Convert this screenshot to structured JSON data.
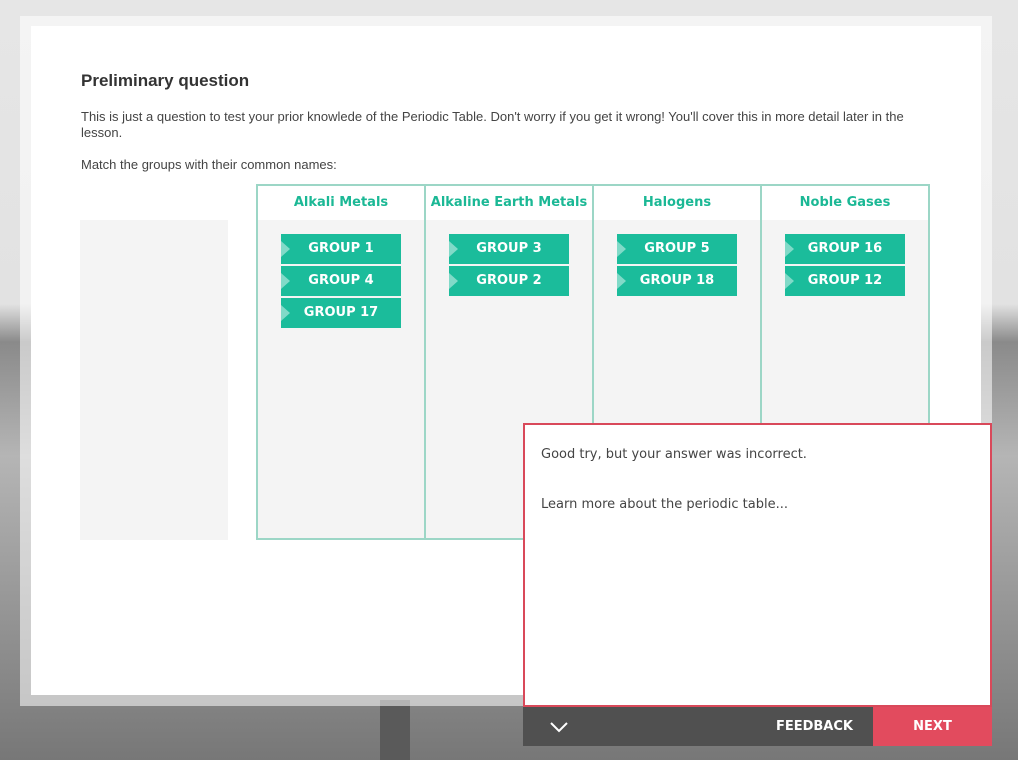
{
  "question": {
    "title": "Preliminary question",
    "intro": "This is just a question to test your prior knowlede of the Periodic Table. Don't worry if you get it wrong! You'll cover this in more detail later in the lesson.",
    "instruction": "Match the groups with their common names:"
  },
  "columns": [
    {
      "heading": "Alkali Metals",
      "chips": [
        "GROUP 1",
        "GROUP 4",
        "GROUP 17"
      ]
    },
    {
      "heading": "Alkaline Earth Metals",
      "chips": [
        "GROUP 3",
        "GROUP 2"
      ]
    },
    {
      "heading": "Halogens",
      "chips": [
        "GROUP 5",
        "GROUP 18"
      ]
    },
    {
      "heading": "Noble Gases",
      "chips": [
        "GROUP 16",
        "GROUP 12"
      ]
    }
  ],
  "feedback": {
    "result": "Good try, but your answer was incorrect.",
    "learn_more": "Learn more about the periodic table..."
  },
  "footer": {
    "collapse_icon": "chevron-down-icon",
    "feedback_label": "FEEDBACK",
    "next_label": "NEXT"
  },
  "colors": {
    "accent": "#1bbc9b",
    "error": "#e24b5e",
    "bar": "#505050"
  }
}
